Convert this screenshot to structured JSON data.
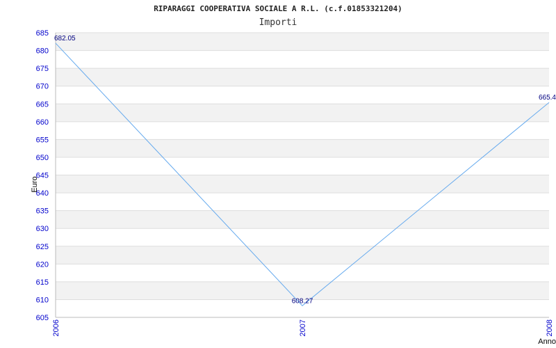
{
  "chart_data": {
    "type": "line",
    "title": "RIPARAGGI COOPERATIVA SOCIALE A R.L. (c.f.01853321204)",
    "subtitle": "Importi",
    "xlabel": "Anno",
    "ylabel": "Euro",
    "categories": [
      "2006",
      "2007",
      "2008"
    ],
    "series": [
      {
        "values": [
          682.05,
          608.27,
          665.4
        ],
        "labels": [
          "682.05",
          "608.27",
          "665.4"
        ]
      }
    ],
    "ylim": [
      605,
      685
    ],
    "ystep": 5,
    "grid": true,
    "line_color": "#66aaee",
    "band_color": "#f2f2f2"
  }
}
